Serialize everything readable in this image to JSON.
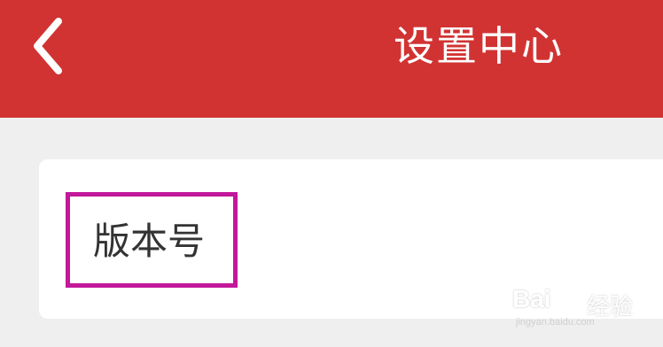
{
  "header": {
    "title": "设置中心",
    "back_icon": "chevron-left-icon"
  },
  "settings": {
    "items": [
      {
        "label": "版本号"
      }
    ]
  },
  "watermark": {
    "logo": "Bai",
    "text": "经验",
    "sub": "jingyan.baidu.com"
  },
  "colors": {
    "header_bg": "#d13332",
    "highlight": "#c2189a"
  }
}
